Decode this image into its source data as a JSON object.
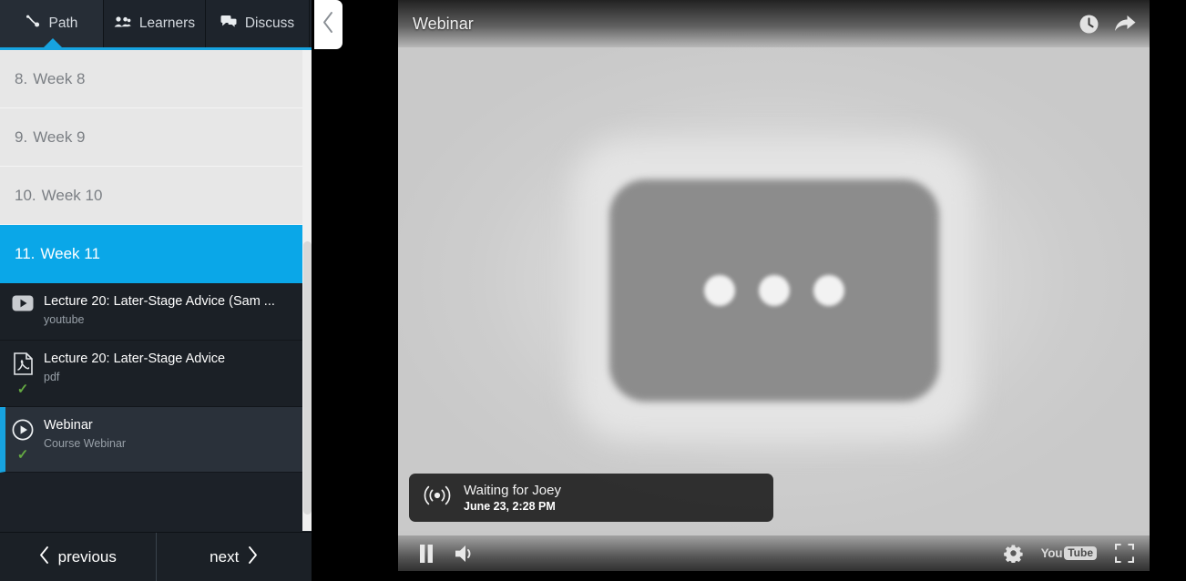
{
  "sidebar": {
    "tabs": [
      {
        "label": "Path",
        "icon": "path-icon",
        "active": true
      },
      {
        "label": "Learners",
        "icon": "people-icon",
        "active": false
      },
      {
        "label": "Discuss",
        "icon": "speech-bubble-icon",
        "active": false
      }
    ],
    "collapse_icon": "chevron-left-icon",
    "weeks": [
      {
        "number": "8.",
        "label": "Week 8",
        "active": false
      },
      {
        "number": "9.",
        "label": "Week 9",
        "active": false
      },
      {
        "number": "10.",
        "label": "Week 10",
        "active": false
      },
      {
        "number": "11.",
        "label": "Week 11",
        "active": true
      }
    ],
    "resources": [
      {
        "title": "Lecture 20: Later-Stage Advice (Sam ...",
        "subtitle": "youtube",
        "icon": "youtube-play-icon",
        "completed": false,
        "selected": false
      },
      {
        "title": "Lecture 20: Later-Stage Advice",
        "subtitle": "pdf",
        "icon": "pdf-file-icon",
        "completed": true,
        "selected": false
      },
      {
        "title": "Webinar",
        "subtitle": "Course Webinar",
        "icon": "circle-play-icon",
        "completed": true,
        "selected": true
      }
    ],
    "bottom_nav": {
      "previous_label": "previous",
      "next_label": "next",
      "previous_icon": "chevron-left-icon",
      "next_icon": "chevron-right-icon"
    }
  },
  "player": {
    "title": "Webinar",
    "header_icons": [
      {
        "name": "watch-later-clock-icon"
      },
      {
        "name": "share-arrow-icon"
      }
    ],
    "toast": {
      "icon": "live-broadcast-icon",
      "title": "Waiting for Joey",
      "subtitle": "June 23, 2:28 PM"
    },
    "controls": {
      "pause_icon": "pause-icon",
      "volume_icon": "volume-icon",
      "settings_icon": "gear-icon",
      "fullscreen_icon": "fullscreen-icon",
      "youtube_logo": {
        "you": "You",
        "tube": "Tube"
      }
    },
    "placeholder": {
      "icon": "loading-ellipsis-placeholder",
      "dots": 3
    }
  },
  "colors": {
    "accent_blue": "#0aa7e8",
    "tab_accent": "#17a3e0",
    "sidebar_bg": "#1c2128",
    "week_bg": "#e7e7e7",
    "check_green": "#64a942"
  }
}
